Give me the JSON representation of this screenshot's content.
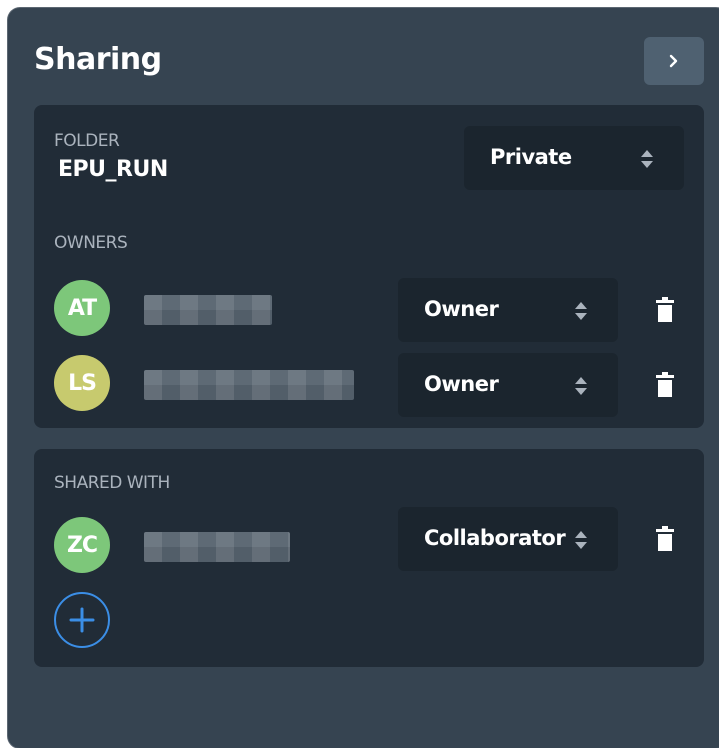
{
  "panel": {
    "title": "Sharing",
    "collapse_icon": "chevron-right-icon"
  },
  "folder_section": {
    "label": "FOLDER",
    "name": "EPU_RUN",
    "visibility": "Private"
  },
  "owners_section": {
    "label": "OWNERS",
    "members": [
      {
        "initials": "AT",
        "name": "",
        "role": "Owner",
        "avatar_color": "#7dc77a"
      },
      {
        "initials": "LS",
        "name": "",
        "role": "Owner",
        "avatar_color": "#c7ca6e"
      }
    ]
  },
  "shared_section": {
    "label": "SHARED WITH",
    "members": [
      {
        "initials": "ZC",
        "name": "",
        "role": "Collaborator",
        "avatar_color": "#7dc77a"
      }
    ],
    "add_icon": "plus-circle-icon"
  },
  "colors": {
    "panel_bg": "#364451",
    "card_bg": "#212c37",
    "select_bg": "#1b252e",
    "accent": "#3b8ee6"
  }
}
